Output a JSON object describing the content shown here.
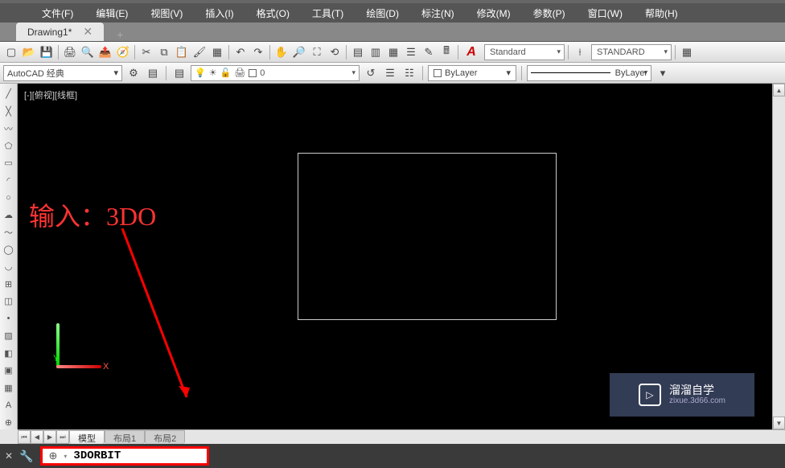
{
  "menus": {
    "file": "文件(F)",
    "edit": "编辑(E)",
    "view": "视图(V)",
    "insert": "插入(I)",
    "format": "格式(O)",
    "tools": "工具(T)",
    "draw": "绘图(D)",
    "annotate": "标注(N)",
    "modify": "修改(M)",
    "param": "参数(P)",
    "window": "窗口(W)",
    "help": "帮助(H)"
  },
  "tab": {
    "name": "Drawing1*",
    "close": "✕",
    "add": "+"
  },
  "workspace": {
    "name": "AutoCAD 经典"
  },
  "layer": {
    "name": "0",
    "bylayer": "ByLayer",
    "linetype": "ByLayer"
  },
  "styles": {
    "text": "Standard",
    "dim": "STANDARD"
  },
  "viewport": {
    "label": "[-][俯视][线框]"
  },
  "axis": {
    "x": "X",
    "y": "Y"
  },
  "overlay": {
    "text": "输入：3DO"
  },
  "layout": {
    "model": "模型",
    "l1": "布局1",
    "l2": "布局2"
  },
  "command": {
    "text": "3DORBIT"
  },
  "watermark": {
    "name": "溜溜自学",
    "url": "zixue.3d66.com"
  }
}
